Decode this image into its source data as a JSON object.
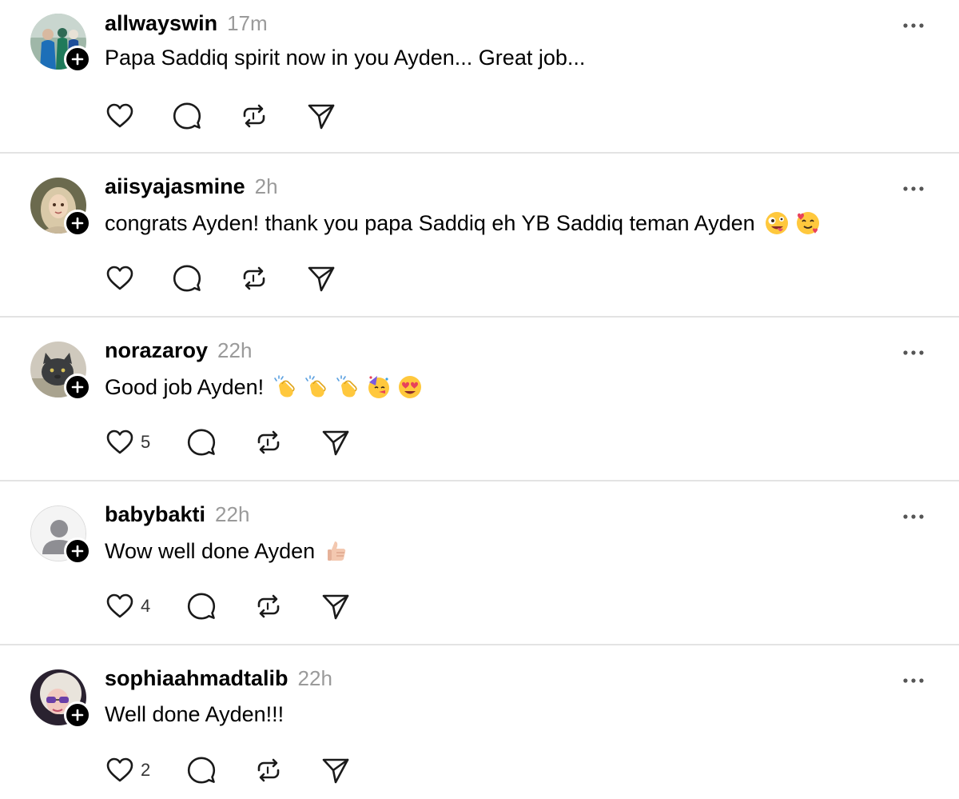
{
  "posts": [
    {
      "username": "allwayswin",
      "time": "17m",
      "text": "Papa Saddiq spirit now in you Ayden... Great job...",
      "emojis": [],
      "likes": ""
    },
    {
      "username": "aiisyajasmine",
      "time": "2h",
      "text": "congrats Ayden! thank you papa Saddiq eh YB Saddiq teman Ayden",
      "emojis": [
        "zany-face-emoji",
        "smiling-face-with-hearts-emoji"
      ],
      "likes": ""
    },
    {
      "username": "norazaroy",
      "time": "22h",
      "text": "Good job Ayden!",
      "emojis": [
        "clapping-hands-emoji",
        "clapping-hands-emoji",
        "clapping-hands-emoji",
        "partying-face-emoji",
        "heart-eyes-emoji"
      ],
      "likes": "5"
    },
    {
      "username": "babybakti",
      "time": "22h",
      "text": "Wow well done Ayden",
      "emojis": [
        "thumbs-up-emoji"
      ],
      "likes": "4"
    },
    {
      "username": "sophiaahmadtalib",
      "time": "22h",
      "text": "Well done Ayden!!!",
      "emojis": [],
      "likes": "2"
    }
  ],
  "icons": {
    "like": "heart-icon",
    "reply": "comment-bubble-icon",
    "repost": "repost-icon",
    "share": "send-icon",
    "more": "more-horizontal-icon",
    "follow": "plus-icon"
  },
  "colors": {
    "text": "#000000",
    "muted": "#9a9a9a",
    "divider": "#e3e3e3",
    "badge": "#000000"
  }
}
